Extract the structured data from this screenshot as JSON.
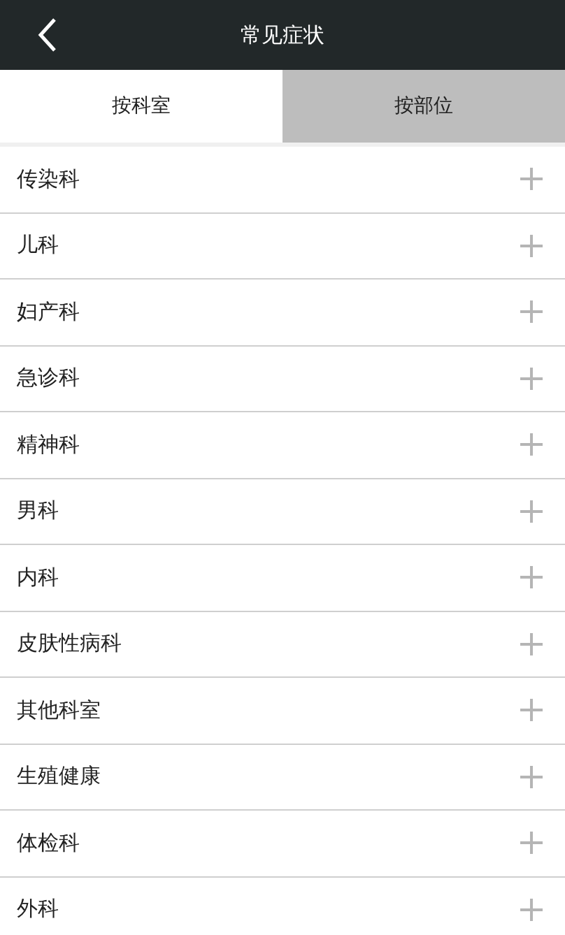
{
  "header": {
    "title": "常见症状"
  },
  "tabs": [
    {
      "label": "按科室",
      "selected": true
    },
    {
      "label": "按部位",
      "selected": false
    }
  ],
  "departments": [
    {
      "name": "传染科"
    },
    {
      "name": "儿科"
    },
    {
      "name": "妇产科"
    },
    {
      "name": "急诊科"
    },
    {
      "name": "精神科"
    },
    {
      "name": "男科"
    },
    {
      "name": "内科"
    },
    {
      "name": "皮肤性病科"
    },
    {
      "name": "其他科室"
    },
    {
      "name": "生殖健康"
    },
    {
      "name": "体检科"
    },
    {
      "name": "外科"
    }
  ]
}
